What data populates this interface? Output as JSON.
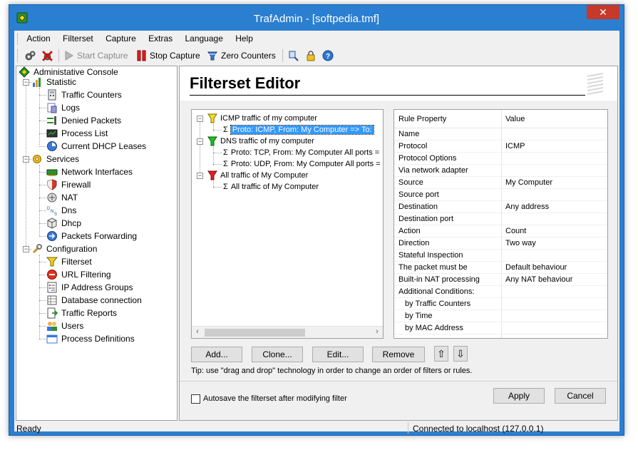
{
  "window": {
    "title": "TrafAdmin - [softpedia.tmf]",
    "close_label": "✕"
  },
  "menu": [
    "Action",
    "Filterset",
    "Capture",
    "Extras",
    "Language",
    "Help"
  ],
  "toolbar": {
    "start_capture": "Start Capture",
    "stop_capture": "Stop Capture",
    "zero_counters": "Zero Counters"
  },
  "sidebar": {
    "root": "Administative Console",
    "statistic": "Statistic",
    "statistic_items": [
      "Traffic Counters",
      "Logs",
      "Denied Packets",
      "Process List",
      "Current DHCP Leases"
    ],
    "services": "Services",
    "services_items": [
      "Network Interfaces",
      "Firewall",
      "NAT",
      "Dns",
      "Dhcp",
      "Packets Forwarding"
    ],
    "configuration": "Configuration",
    "configuration_items": [
      "Filterset",
      "URL Filtering",
      "IP Address Groups",
      "Database connection",
      "Traffic Reports",
      "Users",
      "Process Definitions"
    ]
  },
  "editor": {
    "title": "Filterset Editor",
    "tree": {
      "g1": "ICMP traffic of my computer",
      "g1_rule": "Proto: ICMP, From: My Computer  => To:",
      "g2": "DNS traffic of my computer",
      "g2_rule1": "Proto: TCP, From: My Computer All ports =",
      "g2_rule2": "Proto: UDP, From: My Computer All ports =",
      "g3": "All traffic of My Computer",
      "g3_rule": "All traffic of My Computer"
    },
    "props": {
      "col_property": "Rule Property",
      "col_value": "Value",
      "rows": [
        {
          "k": "Name",
          "v": ""
        },
        {
          "k": "Protocol",
          "v": "ICMP"
        },
        {
          "k": "Protocol Options",
          "v": ""
        },
        {
          "k": "Via network adapter",
          "v": ""
        },
        {
          "k": "Source",
          "v": "My Computer"
        },
        {
          "k": "Source port",
          "v": ""
        },
        {
          "k": "Destination",
          "v": "Any address"
        },
        {
          "k": "Destination port",
          "v": ""
        },
        {
          "k": "Action",
          "v": "Count"
        },
        {
          "k": "Direction",
          "v": "Two way"
        },
        {
          "k": "Stateful Inspection",
          "v": ""
        },
        {
          "k": "The packet must be",
          "v": "Default behaviour"
        },
        {
          "k": "Built-in NAT processing",
          "v": "Any NAT behaviour"
        },
        {
          "k": "Additional Conditions:",
          "v": ""
        },
        {
          "k": "by Traffic Counters",
          "v": ""
        },
        {
          "k": "by Time",
          "v": ""
        },
        {
          "k": "by MAC Address",
          "v": ""
        }
      ]
    },
    "buttons": {
      "add": "Add...",
      "clone": "Clone...",
      "edit": "Edit...",
      "remove": "Remove",
      "up": "⇧",
      "down": "⇩",
      "apply": "Apply",
      "cancel": "Cancel"
    },
    "tip": "Tip: use \"drag and drop\" technology in order to change an order of filters or rules.",
    "autosave_label": "Autosave the filterset after modifying filter",
    "autosave_checked": false
  },
  "status": {
    "left": "Ready",
    "right": "Connected to localhost (127.0.0.1)"
  },
  "colors": {
    "title_bar": "#2b7fd1",
    "selection": "#3399ff",
    "close": "#c7392b"
  }
}
